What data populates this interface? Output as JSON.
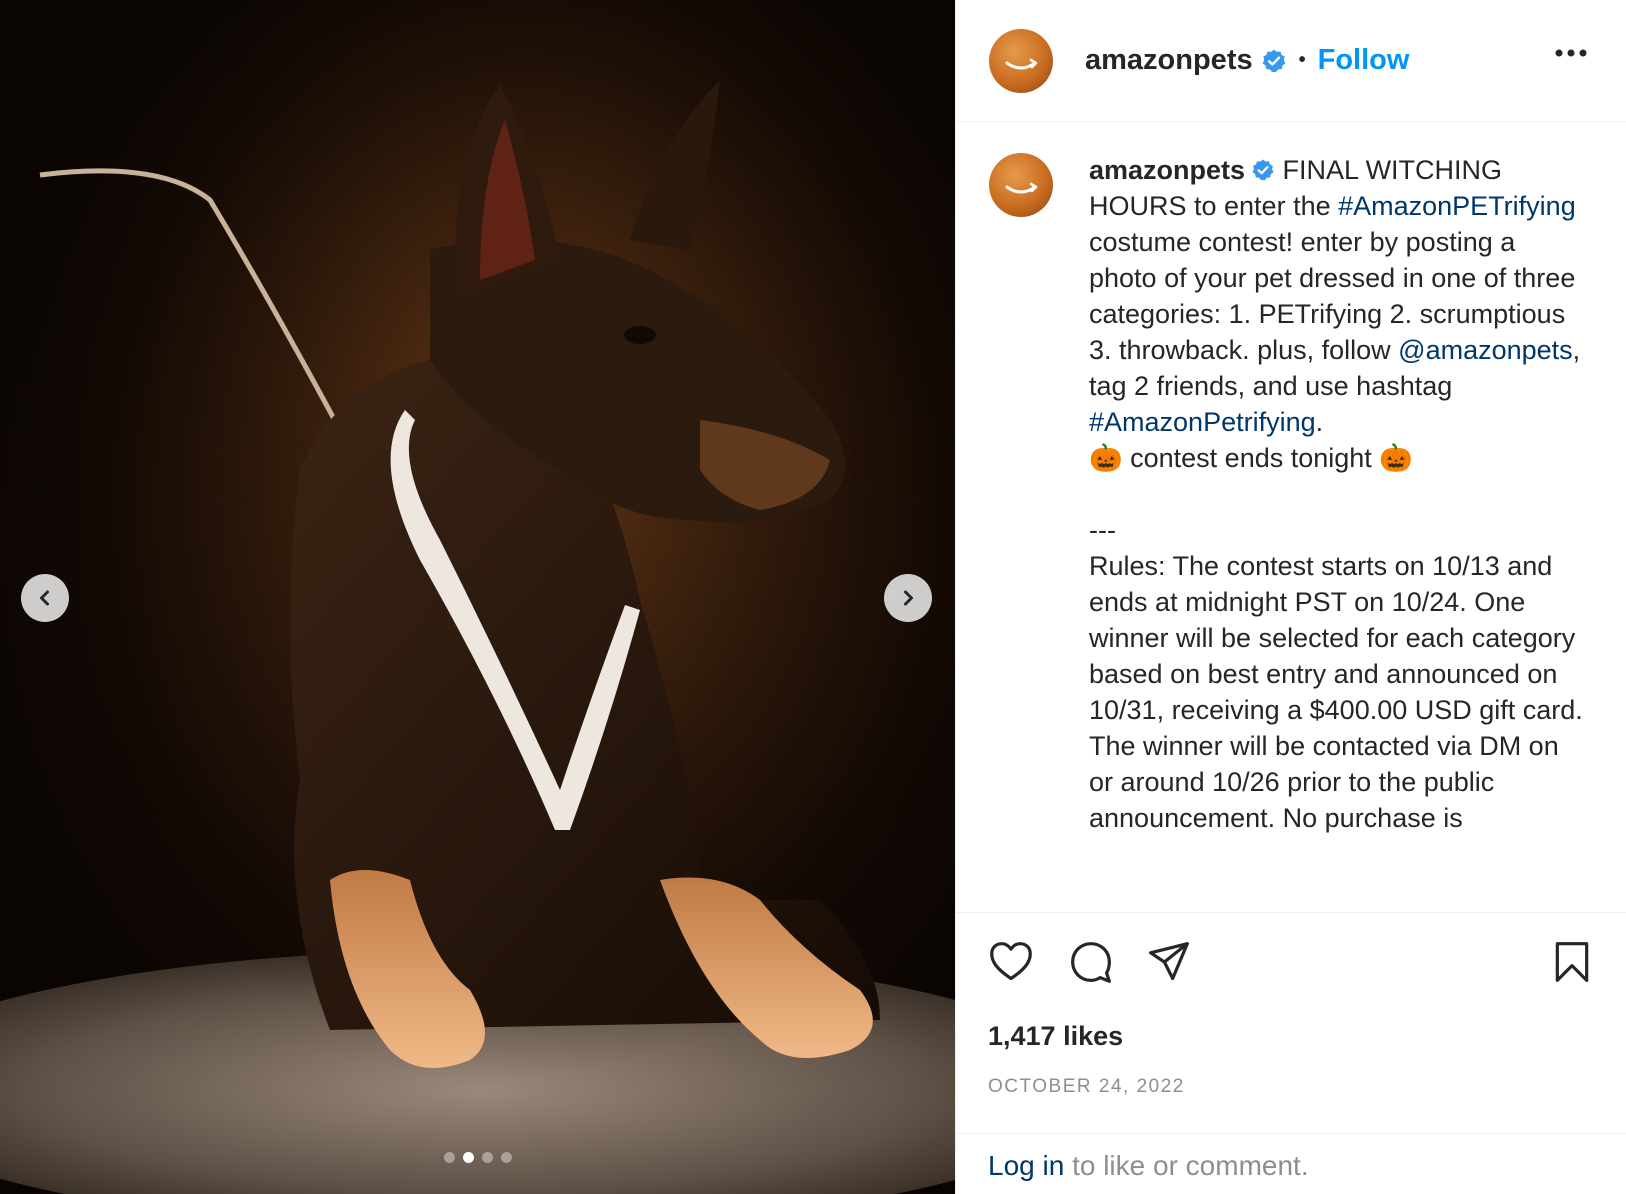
{
  "post": {
    "username": "amazonpets",
    "follow_label": "Follow",
    "separator": "•",
    "verified_icon": "verified-badge-icon",
    "caption": {
      "p1": " FINAL WITCHING HOURS to enter the ",
      "hashtag1": "#AmazonPETrifying",
      "p2": " costume contest! enter by posting a photo of your pet dressed in one of three categories: 1. PETrifying 2. scrumptious 3. throwback. plus, follow ",
      "mention": "@amazonpets",
      "p3": ", tag 2 friends, and use hashtag ",
      "hashtag2": "#AmazonPetrifying",
      "p4": ".\n🎃 contest ends tonight 🎃\n\n---\nRules: The contest starts on 10/13 and ends at midnight PST on 10/24. One winner will be selected for each category based on best entry and announced on 10/31, receiving a $400.00 USD gift card. The winner will be contacted via DM on or around 10/26 prior to the public announcement. No purchase is"
    },
    "likes": "1,417 likes",
    "date": "OCTOBER 24, 2022",
    "login_link": "Log in",
    "login_rest": " to like or comment."
  },
  "carousel": {
    "total": 4,
    "active_index": 1
  },
  "icons": {
    "prev": "chevron-left-icon",
    "next": "chevron-right-icon",
    "more": "more-options-icon",
    "like": "heart-icon",
    "comment": "comment-icon",
    "share": "send-icon",
    "save": "bookmark-icon"
  },
  "colors": {
    "link_blue": "#0095f6",
    "hashtag": "#00376b",
    "verified": "#3897f0",
    "muted": "#8e8e8e"
  }
}
